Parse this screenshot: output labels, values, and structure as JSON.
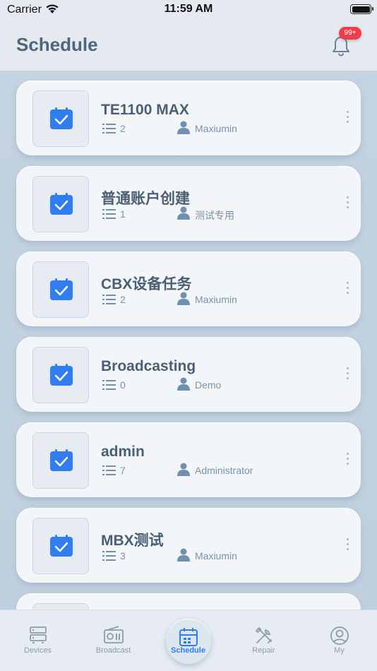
{
  "status_bar": {
    "carrier": "Carrier",
    "time": "11:59 AM"
  },
  "header": {
    "title": "Schedule",
    "notification_badge": "99+"
  },
  "schedules": [
    {
      "title": "TE1100 MAX",
      "count": "2",
      "owner": "Maxiumin"
    },
    {
      "title": "普通账户创建",
      "count": "1",
      "owner": "测试专用"
    },
    {
      "title": "CBX设备任务",
      "count": "2",
      "owner": "Maxiumin"
    },
    {
      "title": "Broadcasting",
      "count": "0",
      "owner": "Demo"
    },
    {
      "title": "admin",
      "count": "7",
      "owner": "Administrator"
    },
    {
      "title": "MBX测试",
      "count": "3",
      "owner": "Maxiumin"
    }
  ],
  "tabs": [
    {
      "label": "Devices",
      "icon": "devices-icon"
    },
    {
      "label": "Broadcast",
      "icon": "radio-icon"
    },
    {
      "label": "Schedule",
      "icon": "calendar-icon",
      "active": true
    },
    {
      "label": "Repair",
      "icon": "tools-icon"
    },
    {
      "label": "My",
      "icon": "user-icon"
    }
  ],
  "colors": {
    "accent": "#2f7df1",
    "badge": "#ef3e4a",
    "title_text": "#4f6579"
  }
}
